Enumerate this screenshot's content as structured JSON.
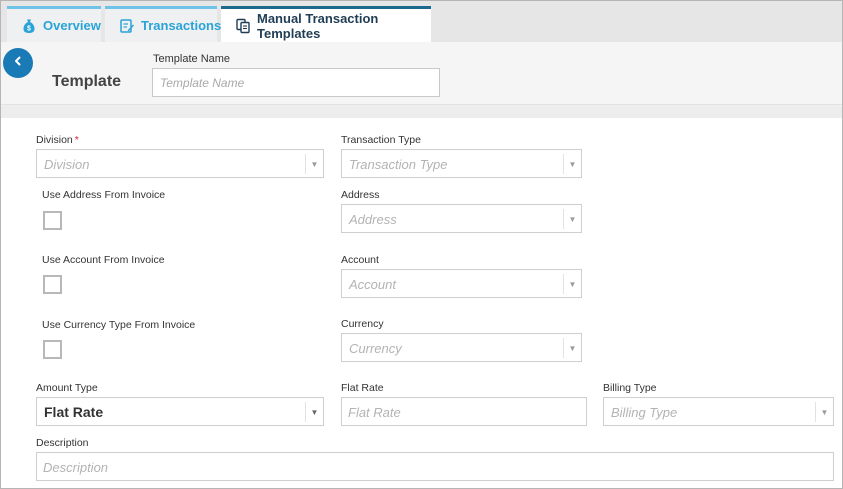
{
  "tabs": {
    "overview": {
      "label": "Overview",
      "icon": "money-bag-icon"
    },
    "transactions": {
      "label": "Transactions",
      "icon": "edit-document-icon"
    },
    "templates": {
      "label": "Manual Transaction Templates",
      "icon": "copy-documents-icon"
    }
  },
  "header": {
    "title": "Template",
    "template_name_label": "Template Name",
    "template_name_placeholder": "Template Name",
    "template_name_value": ""
  },
  "form": {
    "division": {
      "label": "Division",
      "required_mark": "*",
      "placeholder": "Division"
    },
    "transaction_type": {
      "label": "Transaction Type",
      "placeholder": "Transaction Type"
    },
    "use_address": {
      "label": "Use Address From Invoice",
      "checked": false
    },
    "address": {
      "label": "Address",
      "placeholder": "Address"
    },
    "use_account": {
      "label": "Use Account From Invoice",
      "checked": false
    },
    "account": {
      "label": "Account",
      "placeholder": "Account"
    },
    "use_currency": {
      "label": "Use Currency Type From Invoice",
      "checked": false
    },
    "currency": {
      "label": "Currency",
      "placeholder": "Currency"
    },
    "amount_type": {
      "label": "Amount Type",
      "value": "Flat Rate"
    },
    "flat_rate": {
      "label": "Flat Rate",
      "placeholder": "Flat Rate"
    },
    "billing_type": {
      "label": "Billing Type",
      "placeholder": "Billing Type"
    },
    "description": {
      "label": "Description",
      "placeholder": "Description"
    }
  },
  "colors": {
    "accent_blue": "#1a7ab5",
    "tab_text": "#2aa3d8",
    "active_tab_text": "#1f3d55",
    "required": "#d9252a"
  }
}
